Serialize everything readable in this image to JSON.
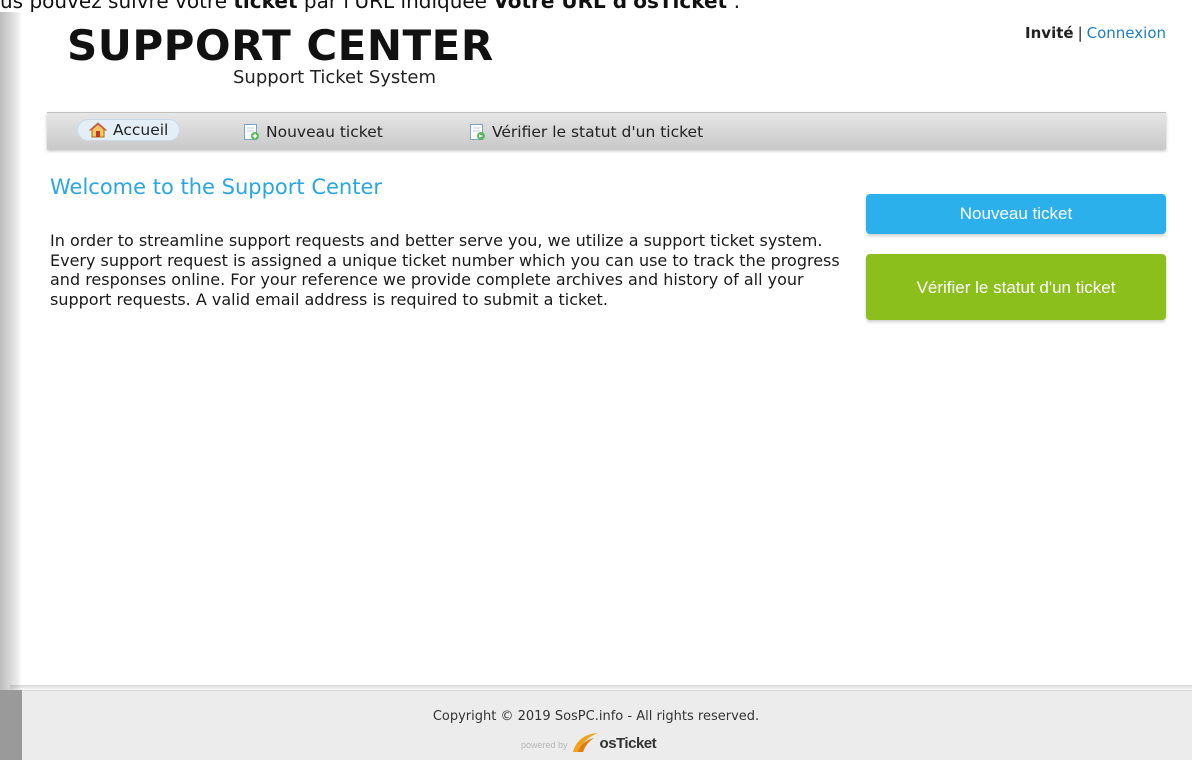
{
  "top_banner": {
    "text_prefix": "us pouvez suivre votre ",
    "text_bold_1": "ticket",
    "text_middle": " par l'URL indiquée ",
    "text_bold_2": "Votre URL d'osTicket",
    "text_suffix": " :"
  },
  "header": {
    "title": "SUPPORT CENTER",
    "subtitle": "Support Ticket System",
    "user_label": "Invité",
    "separator": "|",
    "login_link": "Connexion"
  },
  "nav": {
    "items": [
      {
        "label": "Accueil",
        "icon": "home-icon",
        "active": true
      },
      {
        "label": "Nouveau ticket",
        "icon": "new-ticket-icon",
        "active": false
      },
      {
        "label": "Vérifier le statut d'un ticket",
        "icon": "check-status-icon",
        "active": false
      }
    ]
  },
  "main": {
    "title": "Welcome to the Support Center",
    "intro": "In order to streamline support requests and better serve you, we utilize a support ticket system. Every support request is assigned a unique ticket number which you can use to track the progress and responses online. For your reference we provide complete archives and history of all your support requests. A valid email address is required to submit a ticket."
  },
  "sidebar": {
    "new_ticket_button": "Nouveau ticket",
    "check_status_button": "Vérifier le statut d'un ticket"
  },
  "footer": {
    "copyright": "Copyright © 2019 SosPC.info - All rights reserved.",
    "powered_by": "powered by",
    "brand": "osTicket"
  },
  "colors": {
    "title_blue": "#2aa7e1",
    "link_blue": "#1e7fc0",
    "button_blue": "#2cb0ec",
    "button_green": "#8bbf1c"
  }
}
